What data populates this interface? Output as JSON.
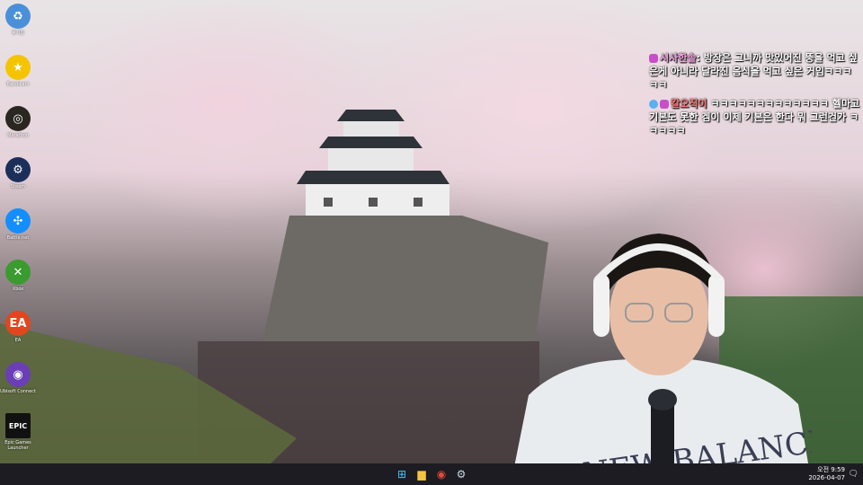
{
  "desktop_icons": [
    {
      "label": "휴지통",
      "icon": "recycle-bin-icon",
      "color": "#4a90d9",
      "glyph": "♻"
    },
    {
      "label": "Bandicam",
      "icon": "star-icon",
      "color": "#f5c400",
      "glyph": "★"
    },
    {
      "label": "Marathon",
      "icon": "marathon-icon",
      "color": "#2a2620",
      "glyph": "◎"
    },
    {
      "label": "Steam",
      "icon": "steam-icon",
      "color": "#1b2f5a",
      "glyph": "⚙"
    },
    {
      "label": "Battle.net",
      "icon": "battlenet-icon",
      "color": "#148eff",
      "glyph": "✣"
    },
    {
      "label": "Xbox",
      "icon": "xbox-icon",
      "color": "#3a9b2f",
      "glyph": "✕"
    },
    {
      "label": "EA",
      "icon": "ea-icon",
      "color": "#e2461d",
      "glyph": "EA"
    },
    {
      "label": "Ubisoft Connect",
      "icon": "ubisoft-icon",
      "color": "#6a3fb5",
      "glyph": "◉"
    },
    {
      "label": "Epic Games Launcher",
      "icon": "epic-games-icon",
      "color": "#111111",
      "glyph": "EPIC"
    }
  ],
  "chat": [
    {
      "nick": "시사한솥",
      "text": "방장은 그니까 맛있어진 뚱을 먹고 싶은게 아니라 달라진 음식을 먹고 싶은 거임ㅋㅋㅋㅋㅋ"
    },
    {
      "nick": "칼오직이",
      "text": "ㅋㅋㅋㅋㅋㅋㅋㅋㅋㅋㅋㅋㅋ 헬마고 기본도 못한 겜이 이제 기본은 한다 뭐 그런건가 ㅋㅋㅋㅋㅋ"
    }
  ],
  "taskbar": {
    "apps": [
      {
        "name": "start",
        "glyph": "⊞",
        "color": "#4cc2ff"
      },
      {
        "name": "file-explorer",
        "glyph": "▆",
        "color": "#f5c342"
      },
      {
        "name": "chrome",
        "glyph": "◉",
        "color": "#e24a3b"
      },
      {
        "name": "steam",
        "glyph": "⚙",
        "color": "#c7d5e0"
      }
    ],
    "time": "오전 9:59",
    "date": "2026-04-07",
    "notification_glyph": "🗨"
  }
}
